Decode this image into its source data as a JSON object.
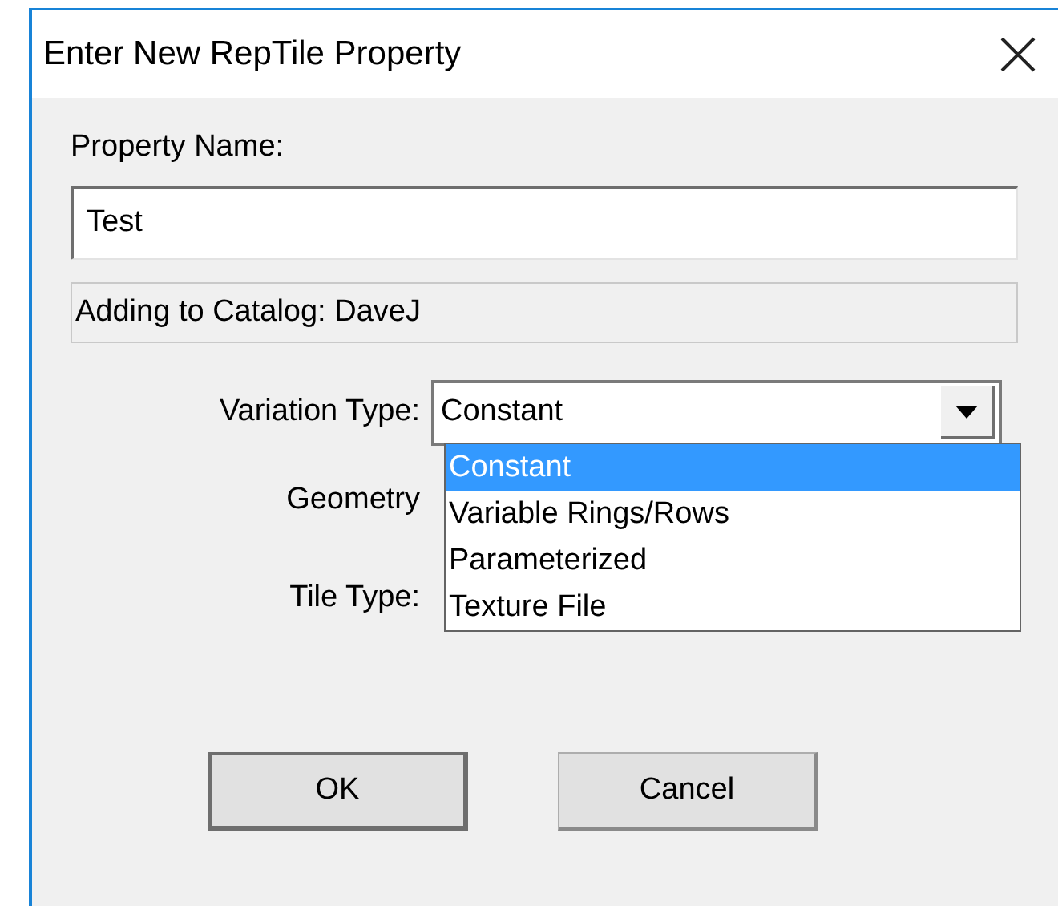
{
  "window": {
    "title": "Enter New RepTile Property"
  },
  "property_name": {
    "label": "Property Name:",
    "value": "Test"
  },
  "catalog_field": {
    "value": "Adding to Catalog: DaveJ"
  },
  "variation_type": {
    "label": "Variation Type:",
    "value": "Constant",
    "expanded": true,
    "options": [
      {
        "label": "Constant",
        "selected": true
      },
      {
        "label": "Variable Rings/Rows",
        "selected": false
      },
      {
        "label": "Parameterized",
        "selected": false
      },
      {
        "label": "Texture File",
        "selected": false
      }
    ]
  },
  "geometry": {
    "label": "Geometry"
  },
  "tile_type": {
    "label": "Tile Type:"
  },
  "buttons": [
    {
      "label": "OK",
      "default": true
    },
    {
      "label": "Cancel",
      "default": false
    }
  ]
}
